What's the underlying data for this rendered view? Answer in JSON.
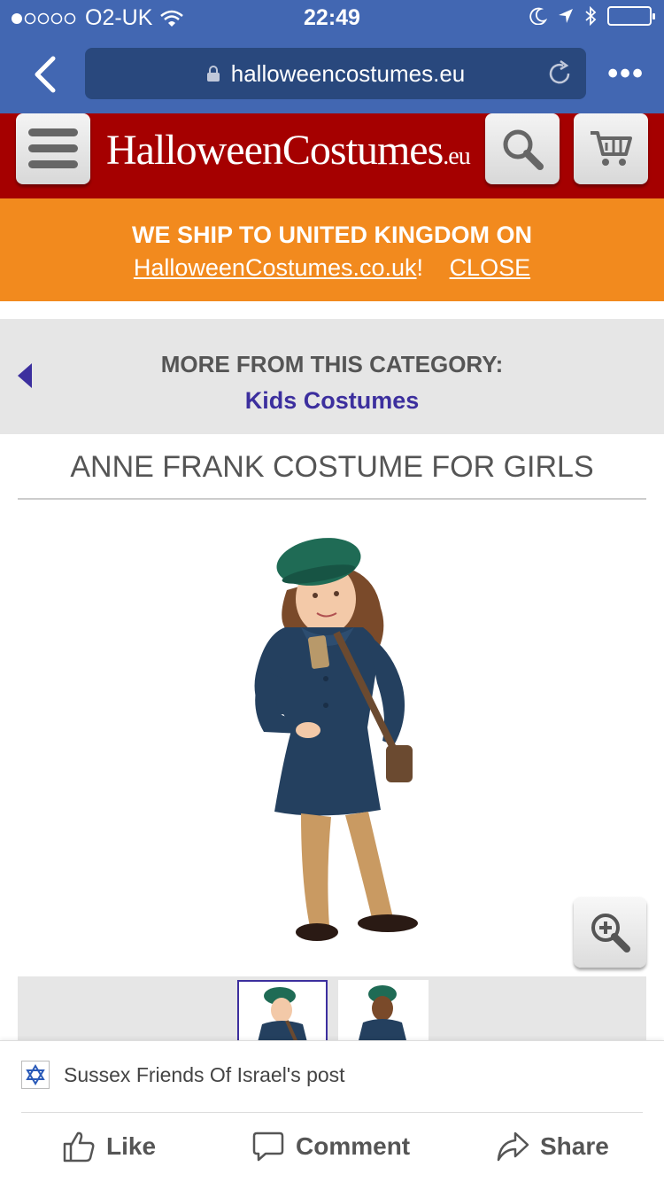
{
  "status_bar": {
    "carrier": "O2-UK",
    "time": "22:49"
  },
  "browser": {
    "url": "halloweencostumes.eu",
    "more_label": "•••"
  },
  "site": {
    "logo_text": "HalloweenCostumes",
    "logo_tld": ".eu"
  },
  "ship_banner": {
    "line1": "WE SHIP TO UNITED KINGDOM ON",
    "link": "HalloweenCostumes.co.uk",
    "separator": "!",
    "close_label": "CLOSE"
  },
  "category": {
    "label": "MORE FROM THIS CATEGORY:",
    "link": "Kids Costumes"
  },
  "product": {
    "title": "ANNE FRANK COSTUME FOR GIRLS"
  },
  "facebook": {
    "post_label": "Sussex Friends Of Israel's post",
    "like_label": "Like",
    "comment_label": "Comment",
    "share_label": "Share"
  },
  "colors": {
    "facebook_blue": "#4267b2",
    "header_red": "#a50000",
    "banner_orange": "#f28a1e",
    "link_purple": "#3c2f9e"
  }
}
